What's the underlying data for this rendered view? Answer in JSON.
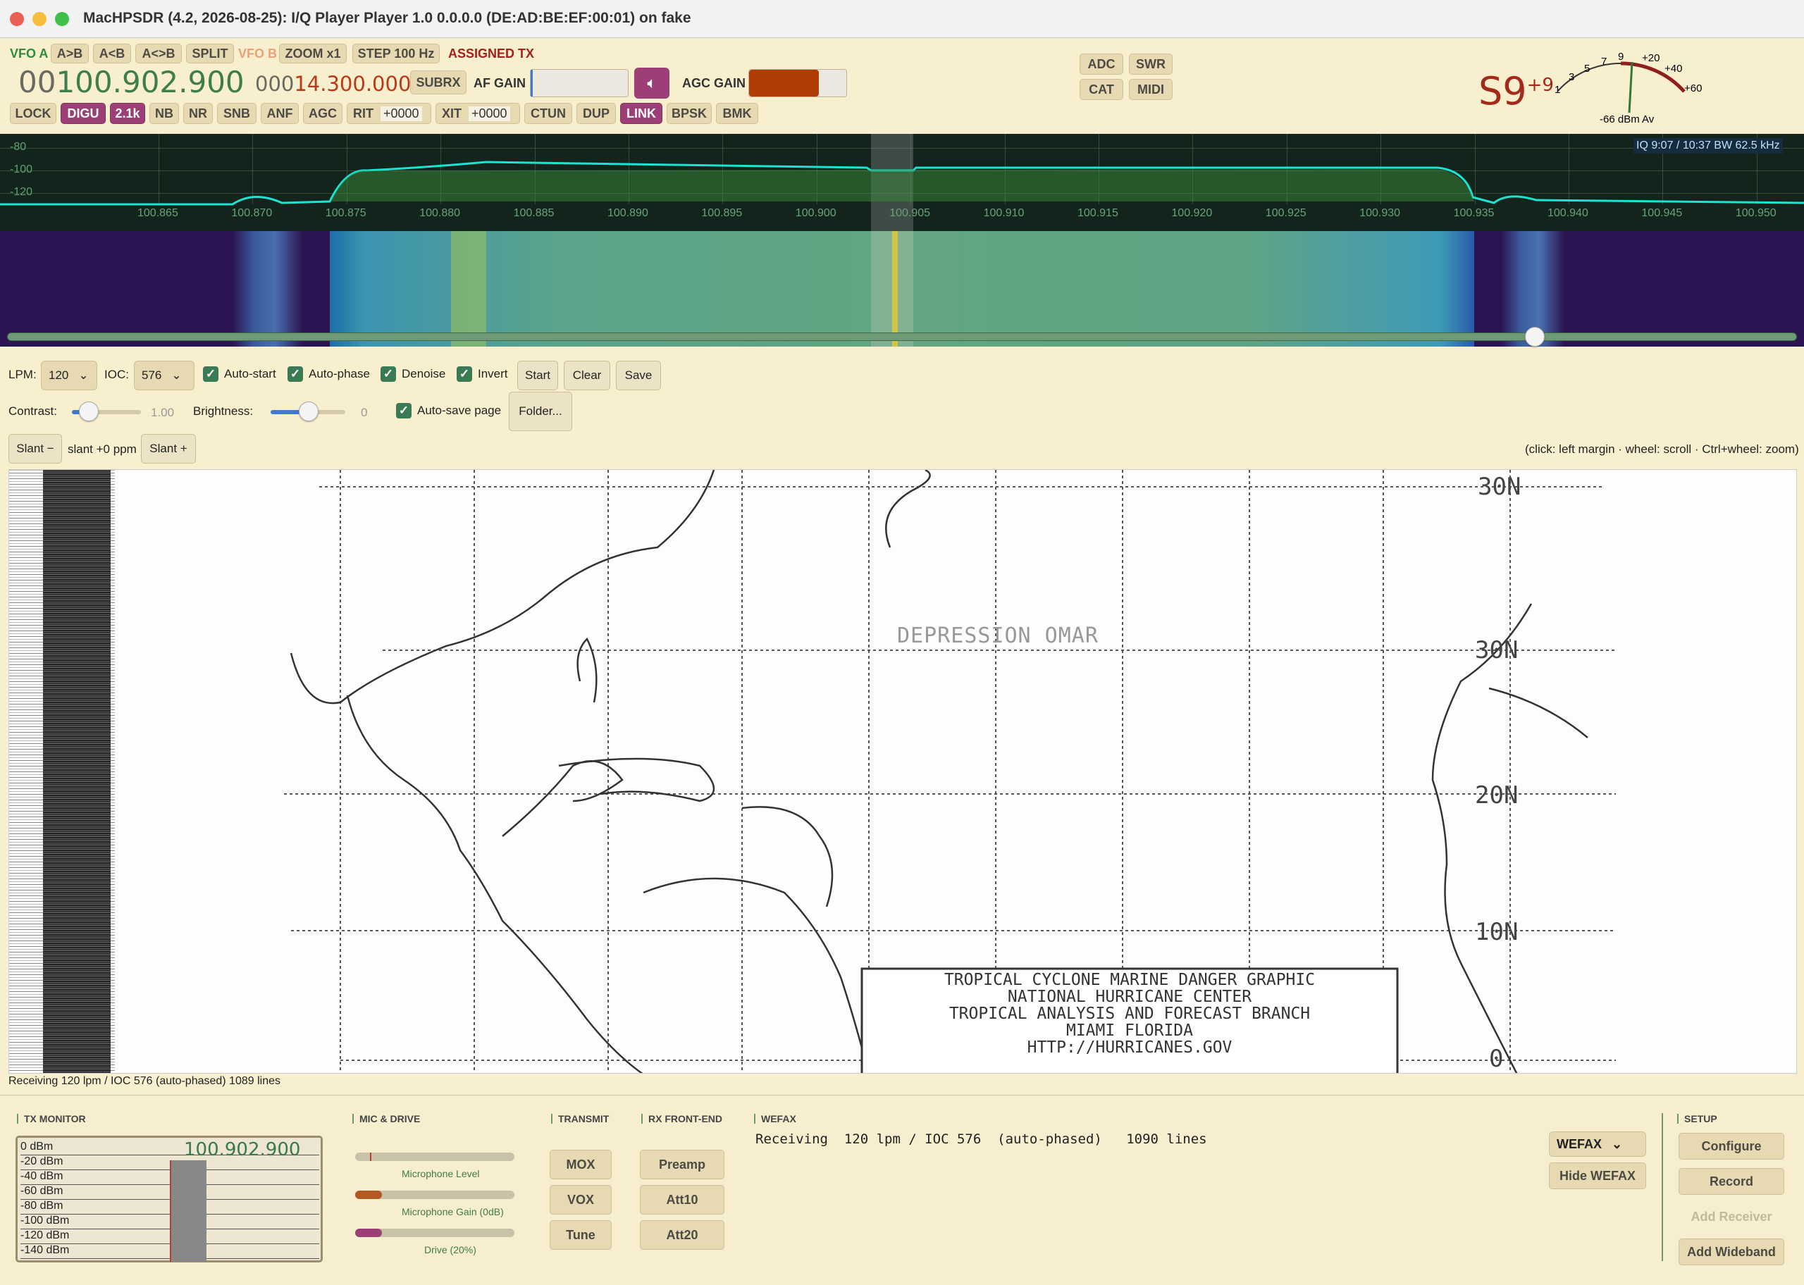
{
  "window": {
    "title": "MacHPSDR (4.2, 2026-08-25): I/Q Player Player 1.0 0.0.0.0 (DE:AD:BE:EF:00:01) on fake"
  },
  "toolbar": {
    "vfo_a": "VFO A",
    "a_to_b": "A>B",
    "b_to_a": "A<B",
    "swap": "A<>B",
    "split": "SPLIT",
    "vfo_b": "VFO B",
    "zoom": "ZOOM x1",
    "step": "STEP 100 Hz",
    "assigned_tx": "ASSIGNED TX"
  },
  "vfo": {
    "a_prefix": "00",
    "a_main": "100.902.900",
    "b_prefix": "000",
    "b_main": "14.300.000"
  },
  "controls": {
    "subrx": "SUBRX",
    "af_gain": "AF GAIN",
    "agc_gain": "AGC GAIN",
    "af_gain_value": 0.02,
    "agc_gain_value": 0.72
  },
  "buttons_row": {
    "lock": "LOCK",
    "digu": "DIGU",
    "bw": "2.1k",
    "nb": "NB",
    "nr": "NR",
    "snb": "SNB",
    "anf": "ANF",
    "agc": "AGC",
    "rit": "RIT",
    "rit_val": "+0000",
    "xit": "XIT",
    "xit_val": "+0000",
    "ctun": "CTUN",
    "dup": "DUP",
    "link": "LINK",
    "bpsk": "BPSK",
    "bmk": "BMK"
  },
  "side_buttons": {
    "adc": "ADC",
    "swr": "SWR",
    "cat": "CAT",
    "midi": "MIDI"
  },
  "smeter": {
    "reading": "S9",
    "over": "+9",
    "scale": [
      "1",
      "3",
      "5",
      "7",
      "9",
      "+20",
      "+40",
      "+60"
    ],
    "dbm": "-66 dBm Av"
  },
  "panadapter": {
    "info": "IQ 9:07 / 10:37   BW 62.5 kHz",
    "db_labels": [
      "-80",
      "-100",
      "-120"
    ],
    "freq_ticks": [
      "100.865",
      "100.870",
      "100.875",
      "100.880",
      "100.885",
      "100.890",
      "100.895",
      "100.900",
      "100.905",
      "100.910",
      "100.915",
      "100.920",
      "100.925",
      "100.930",
      "100.935",
      "100.940",
      "100.945",
      "100.950"
    ]
  },
  "wefax": {
    "lpm_label": "LPM:",
    "lpm": "120",
    "ioc_label": "IOC:",
    "ioc": "576",
    "auto_start": "Auto-start",
    "auto_phase": "Auto-phase",
    "denoise": "Denoise",
    "invert": "Invert",
    "start": "Start",
    "clear": "Clear",
    "save": "Save",
    "contrast_label": "Contrast:",
    "contrast_val": "1.00",
    "brightness_label": "Brightness:",
    "brightness_val": "0",
    "auto_save": "Auto-save page",
    "folder": "Folder...",
    "slant_minus": "Slant −",
    "slant_value": "slant +0 ppm",
    "slant_plus": "Slant +",
    "hint": "(click: left margin · wheel: scroll · Ctrl+wheel: zoom)",
    "status": "Receiving  120 lpm / IOC 576  (auto-phased)   1089 lines",
    "map_labels": {
      "n30": "30N",
      "n20": "20N",
      "n10": "10N",
      "n50": "30N",
      "depression": "DEPRESSION OMAR",
      "zero": "0"
    },
    "map_text": [
      "TROPICAL CYCLONE MARINE DANGER GRAPHIC",
      "NATIONAL HURRICANE CENTER",
      "TROPICAL ANALYSIS AND FORECAST BRANCH",
      "MIAMI FLORIDA",
      "HTTP://HURRICANES.GOV"
    ]
  },
  "bottom": {
    "tx_monitor": "TX MONITOR",
    "tx_freq": "100.902.900",
    "tx_db": [
      "0 dBm",
      "-20 dBm",
      "-40 dBm",
      "-60 dBm",
      "-80 dBm",
      "-100 dBm",
      "-120 dBm",
      "-140 dBm"
    ],
    "mic_drive": "MIC & DRIVE",
    "mic_level": "Microphone Level",
    "mic_gain": "Microphone Gain (0dB)",
    "drive": "Drive (20%)",
    "mic_level_value": 0.1,
    "mic_gain_value": 0.17,
    "drive_value": 0.17,
    "transmit": "TRANSMIT",
    "mox": "MOX",
    "vox": "VOX",
    "tune": "Tune",
    "rx_front": "RX FRONT-END",
    "preamp": "Preamp",
    "att10": "Att10",
    "att20": "Att20",
    "wefax_h": "WEFAX",
    "wefax_status": "Receiving  120 lpm / IOC 576  (auto-phased)   1090 lines",
    "mode_select": "WEFAX",
    "hide_wefax": "Hide WEFAX",
    "setup": "SETUP",
    "configure": "Configure",
    "record": "Record",
    "add_receiver": "Add Receiver",
    "add_wideband": "Add Wideband"
  }
}
